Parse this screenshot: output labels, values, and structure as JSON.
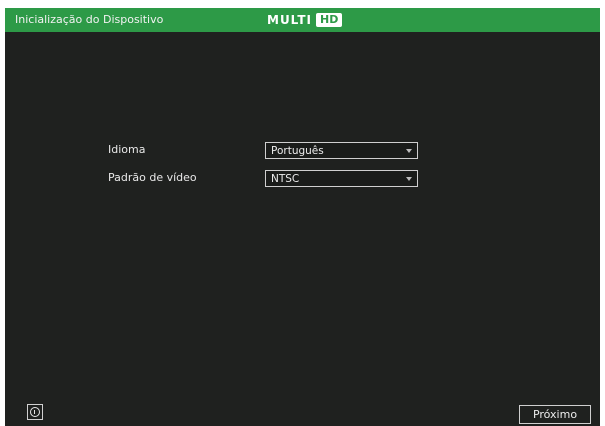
{
  "window": {
    "title": "Inicialização do Dispositivo",
    "logo": {
      "text": "MULTI",
      "badge": "HD"
    }
  },
  "form": {
    "language": {
      "label": "Idioma",
      "value": "Português"
    },
    "video_standard": {
      "label": "Padrão de vídeo",
      "value": "NTSC"
    }
  },
  "footer": {
    "info_icon": "info-circle-icon",
    "next_label": "Próximo"
  },
  "colors": {
    "titlebar": "#2d9a47",
    "background": "#1f211f",
    "text": "#e9e9e9"
  }
}
